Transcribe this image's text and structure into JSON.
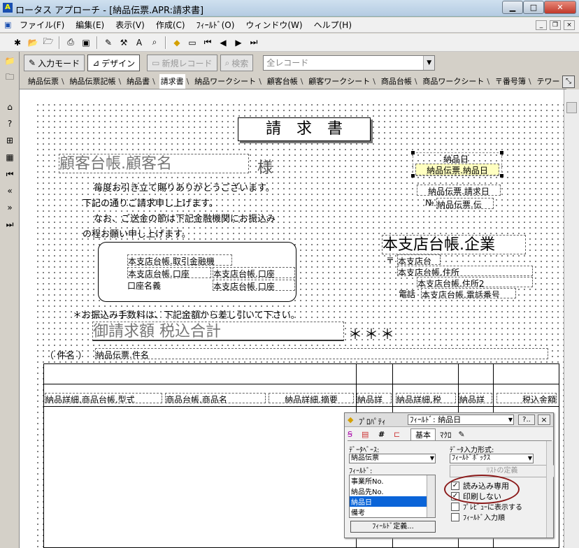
{
  "window": {
    "title": "ロータス アプローチ - [納品伝票.APR:請求書]",
    "app_icon": "approach-icon"
  },
  "menu": [
    "ファイル(F)",
    "編集(E)",
    "表示(V)",
    "作成(C)",
    "ﾌｨｰﾙﾄﾞ(O)",
    "ウィンドウ(W)",
    "ヘルプ(H)"
  ],
  "toolbar2": {
    "input_mode": "入力モード",
    "design": "デザイン",
    "new_record": "新規レコード",
    "search": "検索",
    "record_filter": "全レコード"
  },
  "tabs": [
    "納品伝票",
    "納品伝票記帳",
    "納品書",
    "請求書",
    "納品ワークシート",
    "顧客台帳",
    "顧客ワークシート",
    "商品台帳",
    "商品ワークシート",
    "〒番号簿",
    "テワー"
  ],
  "active_tab": "請求書",
  "form": {
    "heading": "請　求　書",
    "customer_field": "顧客台帳.顧客名",
    "sama": "様",
    "greeting": [
      "毎度お引き立て賜りありがとうございます。",
      "下記の通りご請求申し上げます。",
      "なお、ご送金の節は下記金融機関にお振込み",
      "の程お願い申し上げます。"
    ],
    "bank": {
      "row1": "本支店台帳.取引金融機",
      "row2_label": "本支店台帳.口座",
      "row2_value": "本支店台帳.口座",
      "row3_label": "口座名義",
      "row3_value": "本支店台帳.口座"
    },
    "delivery_date_label": "納品日",
    "delivery_date_field": "納品伝票.納品日",
    "invoice_date_field": "納品伝票.請求日",
    "no_label": "№",
    "no_field": "納品伝票.伝",
    "company_field": "本支店台帳.企業",
    "postal_mark": "〒",
    "branch_field": "本支店台",
    "address1": "本支店台帳.住所",
    "address2": "本支店台帳.住所2",
    "tel_label": "電話",
    "tel_field": "本支店台帳.電話番号",
    "fee_note": "＊お振込み手数料は、下記金額から差し引いて下さい。",
    "total_field": "御請求額 税込合計",
    "stars": "＊＊＊",
    "subject_label": "（ 件名 ）",
    "subject_field": "納品伝票.件名",
    "detail_columns": [
      "納品詳細.商品台帳.型式",
      "商品台帳.商品名",
      "納品詳細.摘要",
      "納品詳",
      "納品詳細.税",
      "納品詳",
      "税込金額"
    ]
  },
  "properties": {
    "title": "ﾌﾟﾛﾊﾟﾃｨ",
    "target": "ﾌｨｰﾙﾄﾞ: 納品日",
    "help": "?..",
    "close": "×",
    "tabs": [
      "基本",
      "ﾏｸﾛ"
    ],
    "database_label": "ﾃﾞｰﾀﾍﾞｰｽ:",
    "database_value": "納品伝票",
    "field_label": "ﾌｨｰﾙﾄﾞ:",
    "fields": [
      "事業所No.",
      "納品先No.",
      "納品日",
      "備考"
    ],
    "selected_field": "納品日",
    "define_button": "ﾌｨｰﾙﾄﾞ定義...",
    "input_format_label": "ﾃﾞｰﾀ入力形式:",
    "input_format_value": "ﾌｨｰﾙﾄﾞﾎﾞｯｸｽ",
    "list_define": "ﾘｽﾄの定義",
    "checks": [
      {
        "label": "読み込み専用",
        "checked": true
      },
      {
        "label": "印刷しない",
        "checked": true
      },
      {
        "label": "ﾌﾟﾚﾋﾞｭｰに表示する",
        "checked": false
      },
      {
        "label": "ﾌｨｰﾙﾄﾞ入力順",
        "checked": false
      }
    ]
  },
  "colors": {
    "accent_circle": "#8b1a1a",
    "selection": "#0a64d8",
    "field_highlight": "#ffffc0"
  }
}
